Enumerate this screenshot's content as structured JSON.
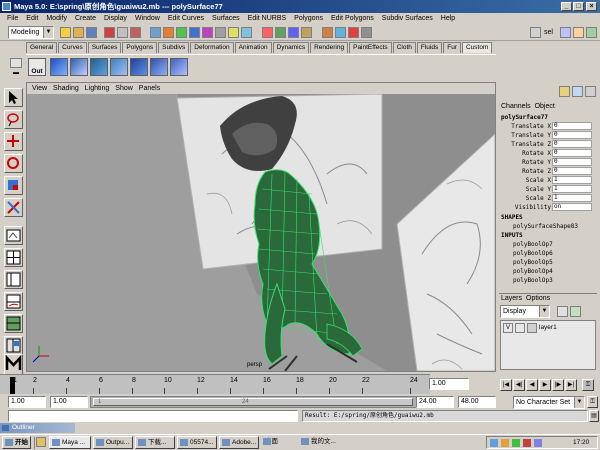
{
  "window": {
    "title": "Maya 5.0: E:\\spring\\原创角色\\guaiwu2.mb  ---  polySurface77"
  },
  "menu": [
    "File",
    "Edit",
    "Modify",
    "Create",
    "Display",
    "Window",
    "Edit Curves",
    "Surfaces",
    "Edit NURBS",
    "Polygons",
    "Edit Polygons",
    "Subdiv Surfaces",
    "Help"
  ],
  "statusline": {
    "mode": "Modeling",
    "sel_label": "sel"
  },
  "shelf": {
    "tabs": [
      "General",
      "Curves",
      "Surfaces",
      "Polygons",
      "Subdivs",
      "Deformation",
      "Animation",
      "Dynamics",
      "Rendering",
      "PaintEffects",
      "Cloth",
      "Fluids",
      "Fur",
      "Custom"
    ],
    "first_icon_label": "Out"
  },
  "panel": {
    "menu": [
      "View",
      "Shading",
      "Lighting",
      "Show",
      "Panels"
    ],
    "camera_label": "persp"
  },
  "channel_box": {
    "tabs": [
      "Channels",
      "Object"
    ],
    "object_name": "polySurface77",
    "attributes": [
      {
        "label": "Translate X",
        "value": "0"
      },
      {
        "label": "Translate Y",
        "value": "0"
      },
      {
        "label": "Translate Z",
        "value": "0"
      },
      {
        "label": "Rotate X",
        "value": "0"
      },
      {
        "label": "Rotate Y",
        "value": "0"
      },
      {
        "label": "Rotate Z",
        "value": "0"
      },
      {
        "label": "Scale X",
        "value": "1"
      },
      {
        "label": "Scale Y",
        "value": "1"
      },
      {
        "label": "Scale Z",
        "value": "1"
      },
      {
        "label": "Visibility",
        "value": "on"
      }
    ],
    "shapes_header": "SHAPES",
    "shape": "polySurfaceShape83",
    "inputs_header": "INPUTS",
    "inputs": [
      "polyBoolOp7",
      "polyBoolOp6",
      "polyBoolOp5",
      "polyBoolOp4",
      "polyBoolOp3"
    ]
  },
  "layers": {
    "tabs": [
      "Layers",
      "Options"
    ],
    "display": "Display",
    "layer_vis": "V",
    "layer_name": "layer1"
  },
  "timeline": {
    "ticks": [
      "1",
      "2",
      "4",
      "6",
      "8",
      "10",
      "12",
      "14",
      "16",
      "18",
      "20",
      "22",
      "24"
    ],
    "current_frame": "1.00"
  },
  "range": {
    "start": "1.00",
    "playback_start": "1.00",
    "slider_start": "1",
    "slider_end": "24",
    "playback_end": "24.00",
    "end": "48.00",
    "character_set": "No Character Set"
  },
  "command": {
    "result": "Result: E:/spring/原创角色/guaiwu2.mb"
  },
  "taskbar": {
    "start": "开始",
    "items": [
      "Maya ...",
      "Outpu...",
      "下载...",
      "05574...",
      "Adobe...",
      "桌面",
      "我的文..."
    ],
    "clock": "17:20"
  },
  "outliner_tab": "Outliner"
}
